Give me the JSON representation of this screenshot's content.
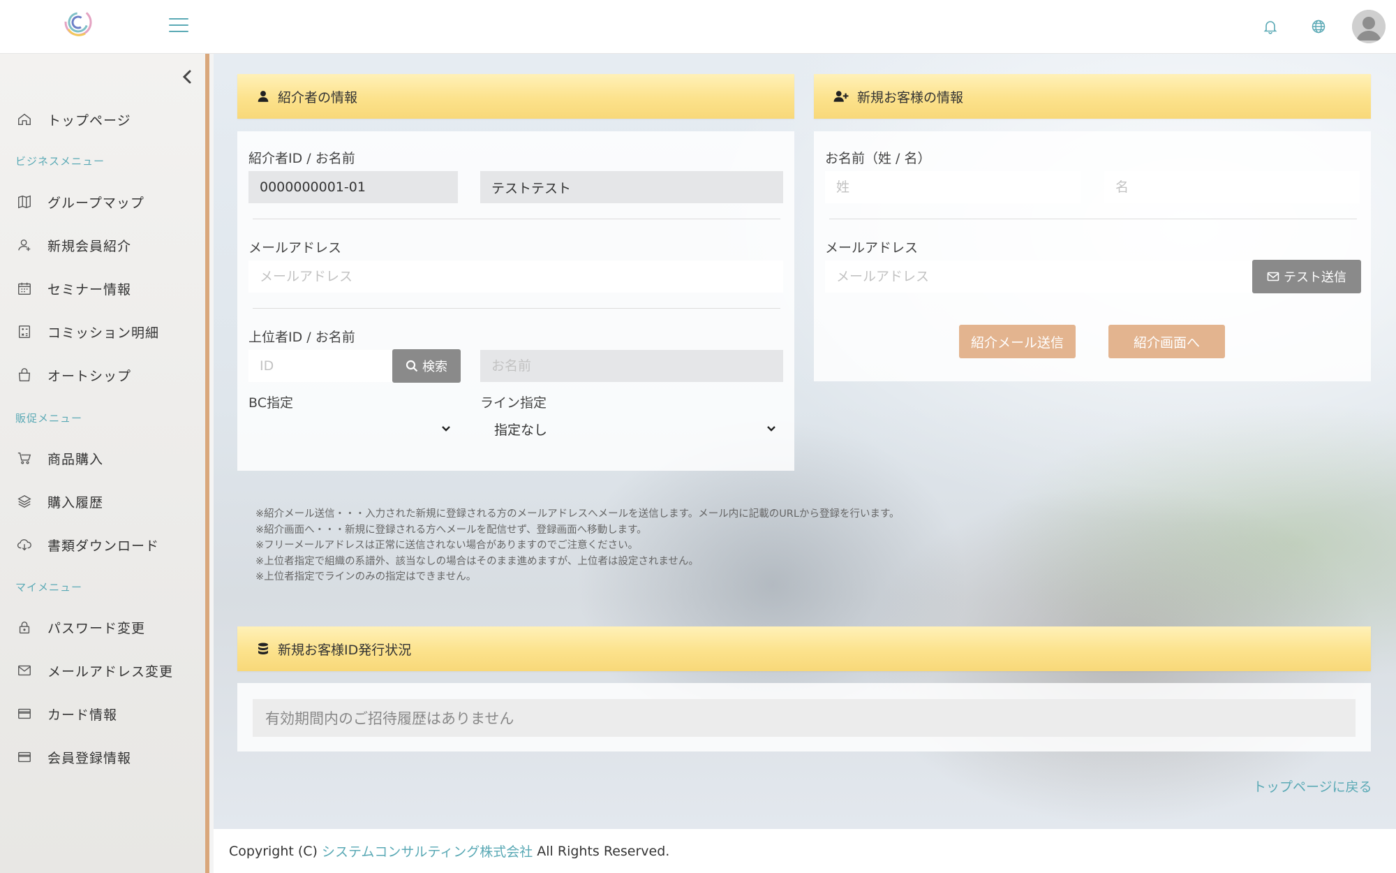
{
  "sidebar": {
    "top_item": "トップページ",
    "sections": [
      {
        "title": "ビジネスメニュー",
        "items": [
          "グループマップ",
          "新規会員紹介",
          "セミナー情報",
          "コミッション明細",
          "オートシップ"
        ]
      },
      {
        "title": "販促メニュー",
        "items": [
          "商品購入",
          "購入履歴",
          "書類ダウンロード"
        ]
      },
      {
        "title": "マイメニュー",
        "items": [
          "パスワード変更",
          "メールアドレス変更",
          "カード情報",
          "会員登録情報"
        ]
      }
    ]
  },
  "referrer": {
    "title": "紹介者の情報",
    "id_label": "紹介者ID / お名前",
    "id_value": "0000000001-01",
    "name_value": "テストテスト",
    "email_label": "メールアドレス",
    "email_placeholder": "メールアドレス",
    "upline_label": "上位者ID / お名前",
    "upline_id_placeholder": "ID",
    "search_button": "検索",
    "upline_name_placeholder": "お名前",
    "bc_label": "BC指定",
    "bc_value": "",
    "line_label": "ライン指定",
    "line_value": "指定なし"
  },
  "new_customer": {
    "title": "新規お客様の情報",
    "name_label": "お名前（姓 / 名）",
    "last_name_placeholder": "姓",
    "first_name_placeholder": "名",
    "email_label": "メールアドレス",
    "email_placeholder": "メールアドレス",
    "test_send_button": "テスト送信",
    "send_button": "紹介メール送信",
    "screen_button": "紹介画面へ"
  },
  "notes": [
    "※紹介メール送信・・・入力された新規に登録される方のメールアドレスへメールを送信します。メール内に記載のURLから登録を行います。",
    "※紹介画面へ・・・新規に登録される方へメールを配信せず、登録画面へ移動します。",
    "※フリーメールアドレスは正常に送信されない場合がありますのでご注意ください。",
    "※上位者指定で組織の系譜外、該当なしの場合はそのまま進めますが、上位者は設定されません。",
    "※上位者指定でラインのみの指定はできません。"
  ],
  "issue_status": {
    "title": "新規お客様ID発行状況",
    "empty_message": "有効期間内のご招待履歴はありません"
  },
  "back_link": "トップページに戻る",
  "footer": {
    "prefix": "Copyright (C)",
    "company": "システムコンサルティング株式会社",
    "suffix": "All Rights Reserved."
  },
  "colors": {
    "accent": "#5aa9b5",
    "header_yellow": "#fce28c",
    "orange_button": "#e3b48f",
    "sidebar_border": "#d9a77b"
  }
}
